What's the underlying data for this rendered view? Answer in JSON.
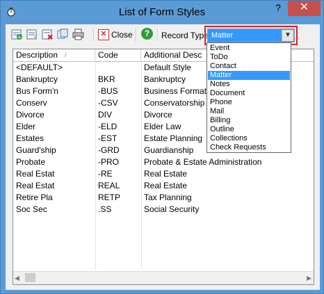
{
  "window": {
    "title": "List of Form Styles",
    "help_glyph": "?",
    "close_glyph": "✕"
  },
  "toolbar": {
    "close_label": "Close",
    "help_glyph": "?",
    "record_type_label": "Record Type",
    "record_type_value": "Matter"
  },
  "grid": {
    "columns": [
      "Description",
      "Code",
      "Additional Desc"
    ],
    "sort_glyph": "/",
    "rows": [
      [
        "<DEFAULT>",
        "",
        "Default Style"
      ],
      [
        "Bankruptcy",
        "BKR",
        "Bankruptcy"
      ],
      [
        "Bus Form'n",
        "-BUS",
        "Business Formation"
      ],
      [
        "Conserv",
        "-CSV",
        "Conservatorship"
      ],
      [
        "Divorce",
        "DIV",
        "Divorce"
      ],
      [
        "Elder",
        "-ELD",
        "Elder Law"
      ],
      [
        "Estates",
        "-EST",
        "Estate Planning"
      ],
      [
        "Guard'ship",
        "-GRD",
        "Guardianship"
      ],
      [
        "Probate",
        "-PRO",
        "Probate & Estate Administration"
      ],
      [
        "Real Estat",
        "-RE",
        "Real Estate"
      ],
      [
        "Real Estat",
        "REAL",
        "Real Estate"
      ],
      [
        "Retire Pla",
        "RETP",
        "Tax Planning"
      ],
      [
        "Soc Sec",
        ".SS",
        "Social Security"
      ]
    ]
  },
  "dropdown": {
    "options": [
      "Event",
      "ToDo",
      "Contact",
      "Matter",
      "Notes",
      "Document",
      "Phone",
      "Mail",
      "Billing",
      "Outline",
      "Collections",
      "Check Requests"
    ],
    "selected_index": 3
  },
  "colors": {
    "title_bar": "#5b9bd5",
    "selection": "#3399ff",
    "highlight_border": "#e02020",
    "close_button": "#c7504a"
  }
}
